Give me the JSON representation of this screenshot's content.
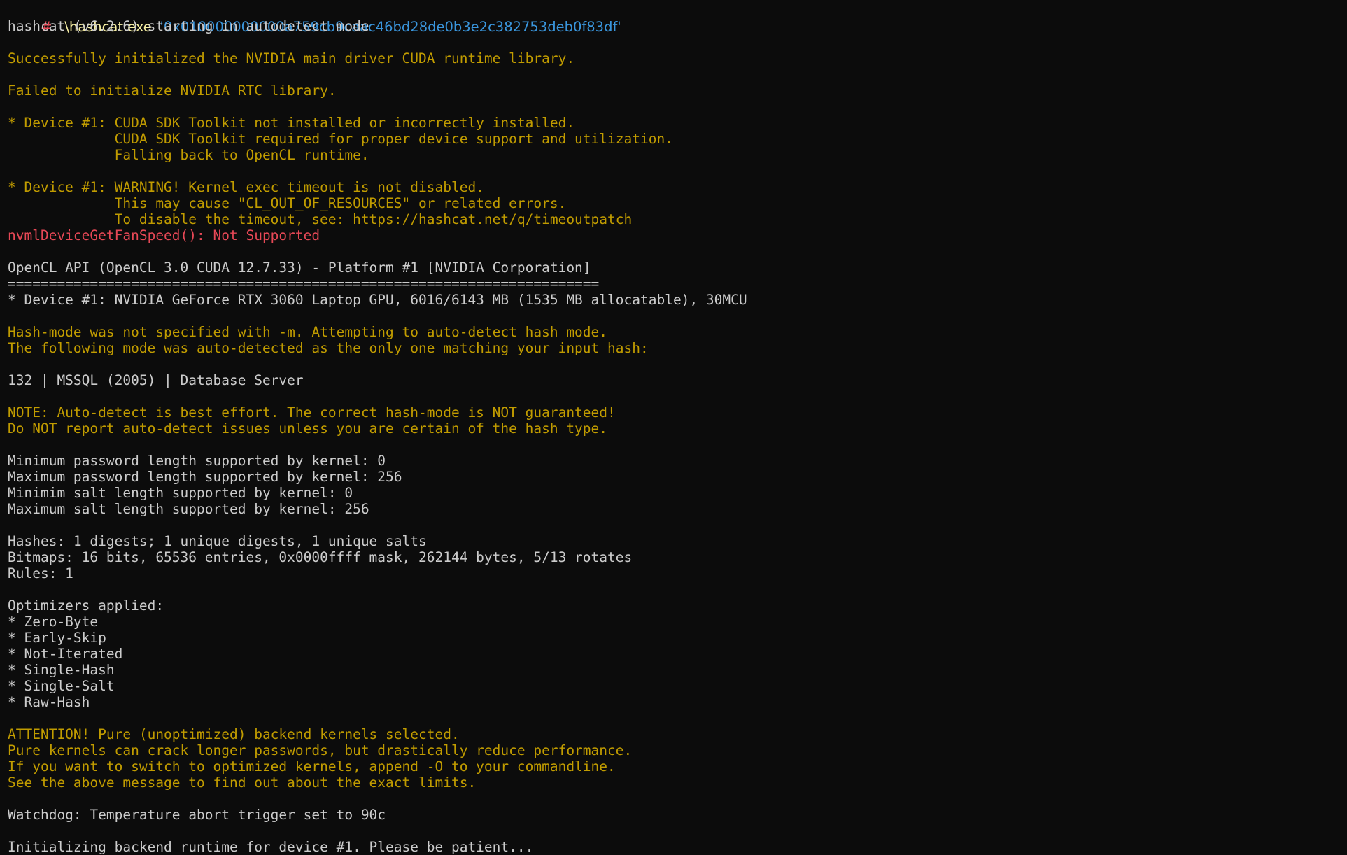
{
  "prompt": {
    "symbol": "#",
    "command": ".\\hashcat.exe",
    "argument": "'0x010000000000a759cb9caac46bd28de0b3e2c382753deb0f83df'"
  },
  "colors": {
    "background": "#0c0c0c",
    "normal_text": "#cccccc",
    "warning_text": "#c19c00",
    "error_text": "#e74856",
    "prompt_symbol": "#e74856",
    "command_text": "#f9f1a5",
    "argument_text": "#3a96dd"
  },
  "output": [
    {
      "text": "hashcat (v6.2.6) starting in autodetect mode",
      "style": "normal"
    },
    {
      "text": "",
      "style": "normal"
    },
    {
      "text": "Successfully initialized the NVIDIA main driver CUDA runtime library.",
      "style": "yellow"
    },
    {
      "text": "",
      "style": "normal"
    },
    {
      "text": "Failed to initialize NVIDIA RTC library.",
      "style": "yellow"
    },
    {
      "text": "",
      "style": "normal"
    },
    {
      "text": "* Device #1: CUDA SDK Toolkit not installed or incorrectly installed.",
      "style": "yellow"
    },
    {
      "text": "             CUDA SDK Toolkit required for proper device support and utilization.",
      "style": "yellow"
    },
    {
      "text": "             Falling back to OpenCL runtime.",
      "style": "yellow"
    },
    {
      "text": "",
      "style": "normal"
    },
    {
      "text": "* Device #1: WARNING! Kernel exec timeout is not disabled.",
      "style": "yellow"
    },
    {
      "text": "             This may cause \"CL_OUT_OF_RESOURCES\" or related errors.",
      "style": "yellow"
    },
    {
      "text": "             To disable the timeout, see: https://hashcat.net/q/timeoutpatch",
      "style": "yellow"
    },
    {
      "text": "nvmlDeviceGetFanSpeed(): Not Supported",
      "style": "red"
    },
    {
      "text": "",
      "style": "normal"
    },
    {
      "text": "OpenCL API (OpenCL 3.0 CUDA 12.7.33) - Platform #1 [NVIDIA Corporation]",
      "style": "normal"
    },
    {
      "text": "========================================================================",
      "style": "normal"
    },
    {
      "text": "* Device #1: NVIDIA GeForce RTX 3060 Laptop GPU, 6016/6143 MB (1535 MB allocatable), 30MCU",
      "style": "normal"
    },
    {
      "text": "",
      "style": "normal"
    },
    {
      "text": "Hash-mode was not specified with -m. Attempting to auto-detect hash mode.",
      "style": "yellow"
    },
    {
      "text": "The following mode was auto-detected as the only one matching your input hash:",
      "style": "yellow"
    },
    {
      "text": "",
      "style": "normal"
    },
    {
      "text": "132 | MSSQL (2005) | Database Server",
      "style": "normal"
    },
    {
      "text": "",
      "style": "normal"
    },
    {
      "text": "NOTE: Auto-detect is best effort. The correct hash-mode is NOT guaranteed!",
      "style": "yellow"
    },
    {
      "text": "Do NOT report auto-detect issues unless you are certain of the hash type.",
      "style": "yellow"
    },
    {
      "text": "",
      "style": "normal"
    },
    {
      "text": "Minimum password length supported by kernel: 0",
      "style": "normal"
    },
    {
      "text": "Maximum password length supported by kernel: 256",
      "style": "normal"
    },
    {
      "text": "Minimim salt length supported by kernel: 0",
      "style": "normal"
    },
    {
      "text": "Maximum salt length supported by kernel: 256",
      "style": "normal"
    },
    {
      "text": "",
      "style": "normal"
    },
    {
      "text": "Hashes: 1 digests; 1 unique digests, 1 unique salts",
      "style": "normal"
    },
    {
      "text": "Bitmaps: 16 bits, 65536 entries, 0x0000ffff mask, 262144 bytes, 5/13 rotates",
      "style": "normal"
    },
    {
      "text": "Rules: 1",
      "style": "normal"
    },
    {
      "text": "",
      "style": "normal"
    },
    {
      "text": "Optimizers applied:",
      "style": "normal"
    },
    {
      "text": "* Zero-Byte",
      "style": "normal"
    },
    {
      "text": "* Early-Skip",
      "style": "normal"
    },
    {
      "text": "* Not-Iterated",
      "style": "normal"
    },
    {
      "text": "* Single-Hash",
      "style": "normal"
    },
    {
      "text": "* Single-Salt",
      "style": "normal"
    },
    {
      "text": "* Raw-Hash",
      "style": "normal"
    },
    {
      "text": "",
      "style": "normal"
    },
    {
      "text": "ATTENTION! Pure (unoptimized) backend kernels selected.",
      "style": "yellow"
    },
    {
      "text": "Pure kernels can crack longer passwords, but drastically reduce performance.",
      "style": "yellow"
    },
    {
      "text": "If you want to switch to optimized kernels, append -O to your commandline.",
      "style": "yellow"
    },
    {
      "text": "See the above message to find out about the exact limits.",
      "style": "yellow"
    },
    {
      "text": "",
      "style": "normal"
    },
    {
      "text": "Watchdog: Temperature abort trigger set to 90c",
      "style": "normal"
    },
    {
      "text": "",
      "style": "normal"
    },
    {
      "text": "Initializing backend runtime for device #1. Please be patient...",
      "style": "normal"
    }
  ]
}
